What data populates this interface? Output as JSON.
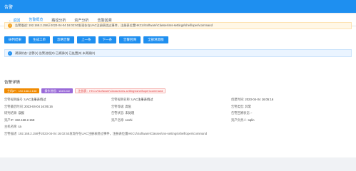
{
  "app": {
    "title": "告警"
  },
  "tabs": [
    {
      "label": "← 返回"
    },
    {
      "label": "告警概览"
    },
    {
      "label": "路径分析"
    },
    {
      "label": "资产分析"
    },
    {
      "label": "告警回溯"
    }
  ],
  "banner": {
    "icon": "warning-icon",
    "text": "告警描述: 192.168.2.158于2023-04-04 16:02:50发现存在UAC注册表绕过事件，注册表位置HKCU\\Software\\Classes\\ms-settings\\shell\\open\\command"
  },
  "buttons": [
    "研判结果",
    "生成工单",
    "忽略告警",
    "上一条",
    "下一条",
    "告警回溯",
    "全部溯源图"
  ],
  "status": {
    "icon": "info-icon",
    "text": "溯源状态: 告警(1) 告警进程(0) 已溯源(0) 已处置(0) 未溯源(0)"
  },
  "detail": {
    "title": "告警详情",
    "tags": [
      {
        "text": "主机IP：192.168.2.158",
        "style": "orange"
      },
      {
        "text": "操作进程：shell.exe",
        "style": "purple"
      },
      {
        "text": "注册表：HKCU\\Software\\Classes\\ms-settings\\shell\\open\\command",
        "style": "red"
      }
    ],
    "rows": [
      [
        {
          "k": "告警规则编号:",
          "v": "UAC注册表绕过"
        },
        {
          "k": "告警规则名称:",
          "v": "UAC注册表绕过"
        },
        {
          "k": "创建时间:",
          "v": "2023-04-04 16:05:16"
        }
      ],
      [
        {
          "k": "告警最后时间:",
          "v": "2023-04-04 16:05:16"
        },
        {
          "k": "告警等级:",
          "v": "高危"
        },
        {
          "k": "告警类型:",
          "v": "异常"
        }
      ],
      [
        {
          "k": "研判结果:",
          "v": "误报"
        },
        {
          "k": "告警状态:",
          "v": "未处理"
        },
        {
          "k": "告警回溯状态:",
          "v": "-"
        }
      ],
      [
        {
          "k": "资产IP:",
          "v": "192.168.2.158"
        },
        {
          "k": "资产名称:",
          "v": "ceshi"
        },
        {
          "k": "资产负责人:",
          "v": "sqlin"
        }
      ],
      [
        {
          "k": "主机名称:",
          "v": "ca"
        }
      ]
    ],
    "description": "告警描述: 192.168.2.158于2023-04-04 16:02:50发现存在UAC注册表绕过事件，注册表位置HKCU\\Software\\Classes\\ms-settings\\shell\\open\\command"
  }
}
